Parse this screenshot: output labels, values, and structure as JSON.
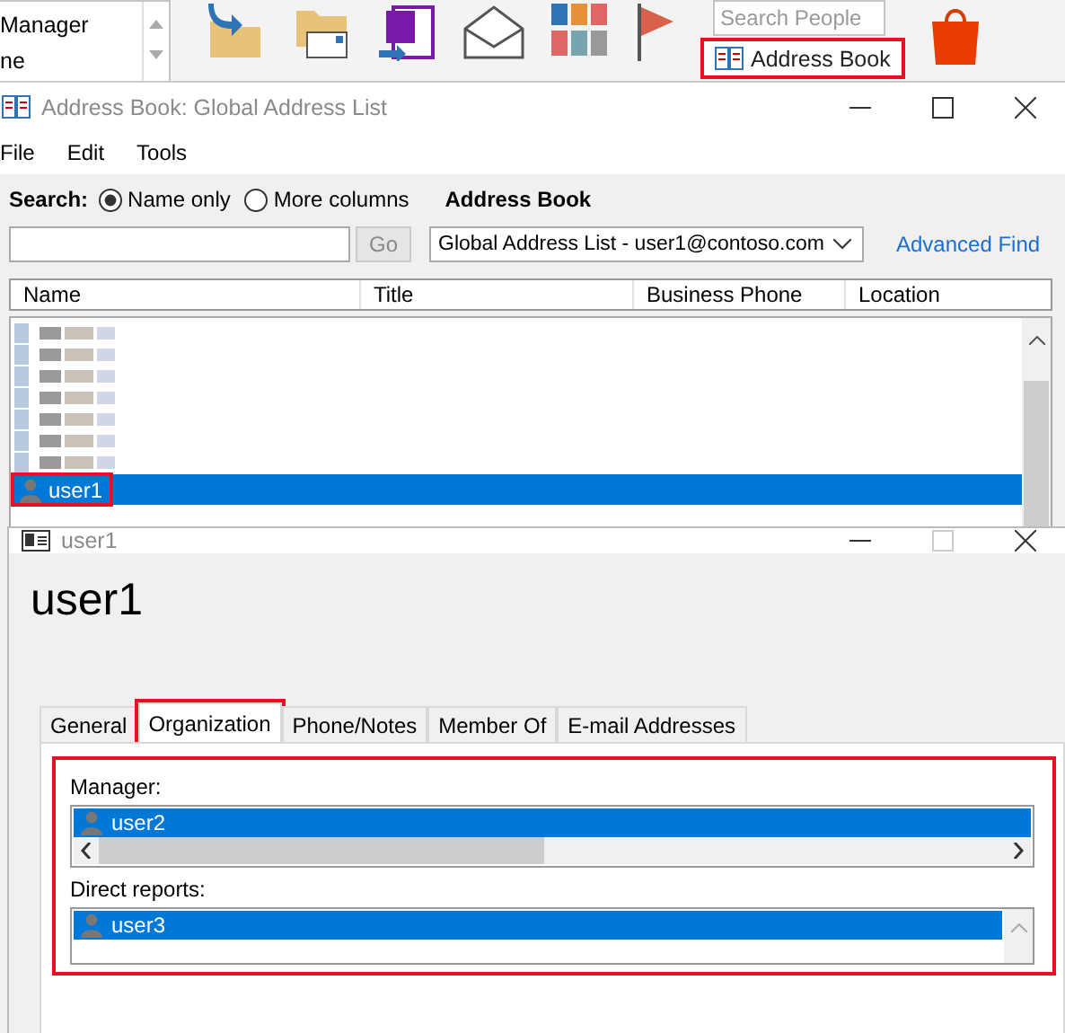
{
  "ribbon": {
    "list_items": [
      "Manager",
      "ne"
    ],
    "search": {
      "placeholder": "Search People"
    },
    "address_book_button": {
      "label": "Address Book",
      "highlighted": true
    }
  },
  "address_book_window": {
    "title": "Address Book: Global Address List",
    "menu": [
      "File",
      "Edit",
      "Tools"
    ],
    "search_label": "Search:",
    "search_options": [
      {
        "label": "Name only",
        "selected": true
      },
      {
        "label": "More columns",
        "selected": false
      }
    ],
    "address_book_label": "Address Book",
    "go_button": {
      "label": "Go",
      "disabled": true
    },
    "address_book_select": {
      "value": "Global Address List - user1@contoso.com"
    },
    "advanced_find": "Advanced Find",
    "columns": [
      "Name",
      "Title",
      "Business Phone",
      "Location"
    ],
    "rows": [
      {
        "kind": "redacted",
        "selected": false
      },
      {
        "kind": "redacted",
        "selected": false
      },
      {
        "kind": "redacted",
        "selected": false
      },
      {
        "kind": "redacted",
        "selected": false
      },
      {
        "kind": "redacted",
        "selected": false
      },
      {
        "kind": "redacted",
        "selected": false
      },
      {
        "kind": "redacted",
        "selected": false
      },
      {
        "kind": "contact",
        "name": "user1",
        "selected": true,
        "highlighted": true
      }
    ]
  },
  "contact_dialog": {
    "title": "user1",
    "heading": "user1",
    "tabs": [
      {
        "label": "General",
        "selected": false,
        "highlighted": false
      },
      {
        "label": "Organization",
        "selected": true,
        "highlighted": true
      },
      {
        "label": "Phone/Notes",
        "selected": false,
        "highlighted": false
      },
      {
        "label": "Member Of",
        "selected": false,
        "highlighted": false
      },
      {
        "label": "E-mail Addresses",
        "selected": false,
        "highlighted": false
      }
    ],
    "organization": {
      "highlighted": true,
      "manager_label": "Manager:",
      "manager": [
        {
          "name": "user2",
          "selected": true
        }
      ],
      "reports_label": "Direct reports:",
      "direct_reports": [
        {
          "name": "user3",
          "selected": true
        }
      ]
    }
  }
}
